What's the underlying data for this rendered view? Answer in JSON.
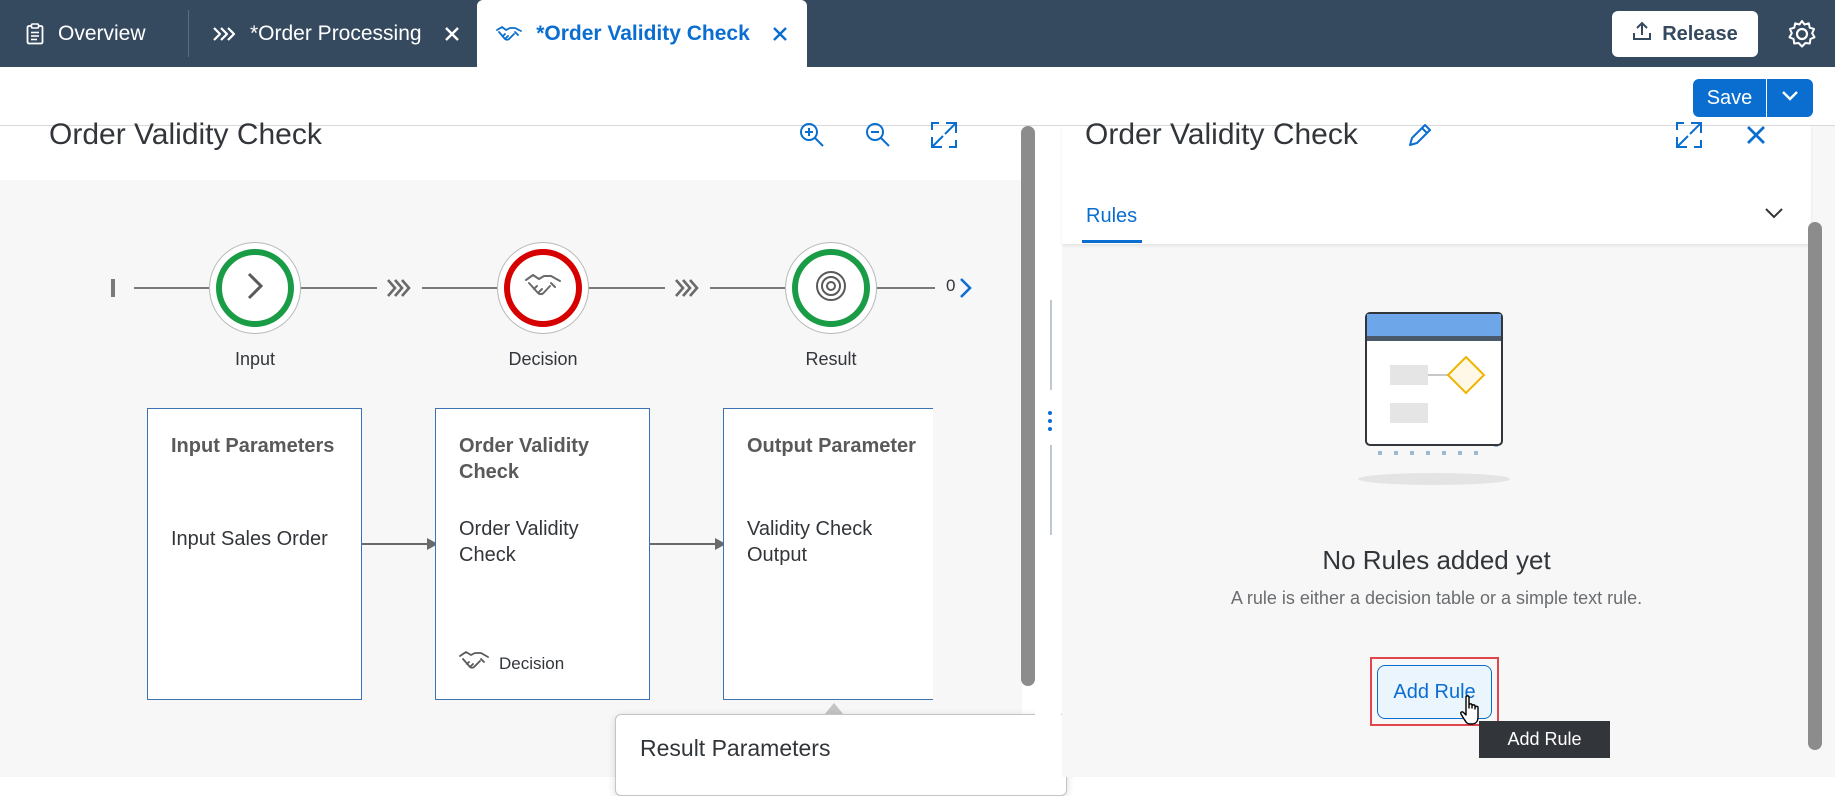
{
  "tabs": [
    {
      "label": "Overview",
      "icon": "clipboard-icon",
      "closable": false,
      "active": false
    },
    {
      "label": "*Order Processing",
      "icon": "process-chevrons-icon",
      "closable": true,
      "active": false
    },
    {
      "label": "*Order Validity Check",
      "icon": "handshake-icon",
      "closable": true,
      "active": true
    }
  ],
  "header": {
    "release_label": "Release",
    "release_icon": "upload-icon",
    "settings_icon": "gear-icon"
  },
  "toolbar": {
    "save_label": "Save",
    "save_menu_icon": "chevron-down-icon"
  },
  "left_panel": {
    "title": "Order Validity Check",
    "icons": [
      "zoom-in-icon",
      "zoom-out-icon",
      "fullscreen-icon"
    ],
    "flow": {
      "nodes": [
        {
          "label": "Input",
          "color": "#1a9c47",
          "icon": "chevron-right-icon"
        },
        {
          "label": "Decision",
          "color": "#d60000",
          "icon": "handshake-icon"
        },
        {
          "label": "Result",
          "color": "#1a9c47",
          "icon": "target-icon"
        }
      ],
      "end_count": "0"
    },
    "cards": [
      {
        "title": "Input Parameters",
        "value": "Input Sales Order",
        "footer": ""
      },
      {
        "title": "Order Validity Check",
        "value": "Order Validity Check",
        "footer": "Decision"
      },
      {
        "title": "Output Parameter",
        "value": "Validity Check Output",
        "footer": ""
      }
    ],
    "popover_label": "Result Parameters"
  },
  "right_panel": {
    "title": "Order Validity Check",
    "tab_label": "Rules",
    "empty_title": "No Rules added yet",
    "empty_desc": "A rule is either a decision table or a simple text rule.",
    "add_rule_label": "Add Rule",
    "tooltip": "Add Rule"
  },
  "colors": {
    "shell": "#354a5f",
    "accent": "#0a6ed1",
    "success": "#1a9c47",
    "error": "#d60000"
  }
}
